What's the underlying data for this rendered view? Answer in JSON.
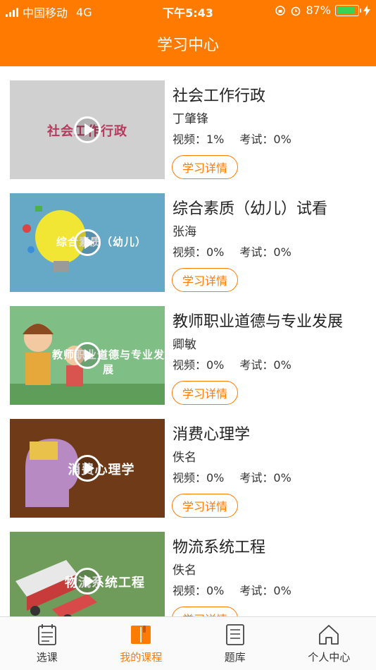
{
  "status": {
    "carrier": "中国移动",
    "network": "4G",
    "time": "下午5:43",
    "battery": "87%",
    "battery_level": 0.87
  },
  "header": {
    "title": "学习中心"
  },
  "courses": [
    {
      "title": "社会工作行政",
      "teacher": "丁肇锋",
      "video": "视频：1%",
      "exam": "考试：0%",
      "button": "学习详情",
      "thumb_caption": "社会工作行政",
      "thumb_bg": "#d0d0d0",
      "thumb_fg": "#b53a5e"
    },
    {
      "title": "综合素质（幼儿）试看",
      "teacher": "张海",
      "video": "视频：0%",
      "exam": "考试：0%",
      "button": "学习详情",
      "thumb_caption": "综合素质（幼儿）",
      "thumb_bg": "#66a9c7",
      "thumb_fg": "#ffffff"
    },
    {
      "title": "教师职业道德与专业发展",
      "teacher": "卿敏",
      "video": "视频：0%",
      "exam": "考试：0%",
      "button": "学习详情",
      "thumb_caption": "教师职业道德与专业发展",
      "thumb_bg": "#7fbf86",
      "thumb_fg": "#ffffff"
    },
    {
      "title": "消费心理学",
      "teacher": "佚名",
      "video": "视频：0%",
      "exam": "考试：0%",
      "button": "学习详情",
      "thumb_caption": "消费心理学",
      "thumb_bg": "#6e3a17",
      "thumb_fg": "#ffffff"
    },
    {
      "title": "物流系统工程",
      "teacher": "佚名",
      "video": "视频：0%",
      "exam": "考试：0%",
      "button": "学习详情",
      "thumb_caption": "物流系统工程",
      "thumb_bg": "#6f9c5a",
      "thumb_fg": "#ffffff"
    }
  ],
  "tabs": [
    {
      "label": "选课",
      "icon": "course-select-icon",
      "active": false
    },
    {
      "label": "我的课程",
      "icon": "my-courses-book-icon",
      "active": true
    },
    {
      "label": "题库",
      "icon": "question-bank-icon",
      "active": false
    },
    {
      "label": "个人中心",
      "icon": "home-icon",
      "active": false
    }
  ],
  "colors": {
    "accent": "#ff7a00"
  }
}
